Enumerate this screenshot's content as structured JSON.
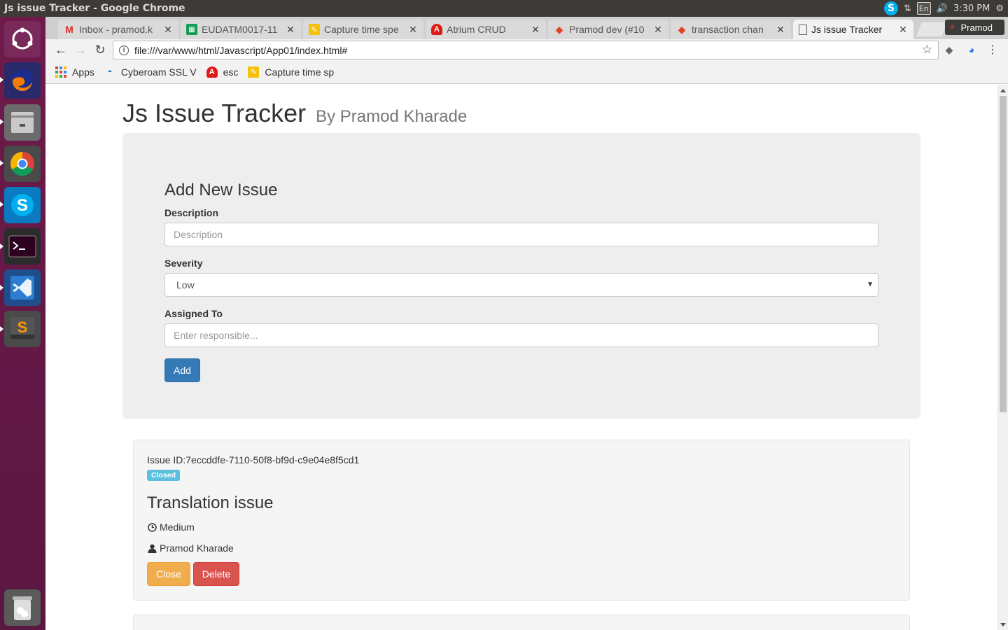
{
  "window": {
    "title": "Js issue Tracker - Google Chrome"
  },
  "system_tray": {
    "language": "En",
    "clock": "3:30 PM"
  },
  "tabs": [
    {
      "label": "Inbox - pramod.k",
      "icon": "gmail-icon"
    },
    {
      "label": "EUDATM0017-11",
      "icon": "sheets-icon"
    },
    {
      "label": "Capture time spe",
      "icon": "capture-icon"
    },
    {
      "label": "Atrium CRUD",
      "icon": "angular-icon"
    },
    {
      "label": "Pramod dev (#10",
      "icon": "gitlab-icon"
    },
    {
      "label": "transaction chan",
      "icon": "gitlab-icon"
    },
    {
      "label": "Js issue Tracker",
      "icon": "page-icon"
    }
  ],
  "profile": {
    "name": "Pramod"
  },
  "address_bar": {
    "url": "file:///var/www/html/Javascript/App01/index.html#"
  },
  "bookmarks": [
    {
      "label": "Apps",
      "icon": "apps-grid-icon"
    },
    {
      "label": "Cyberoam SSL V",
      "icon": "cyberoam-icon"
    },
    {
      "label": "esc",
      "icon": "angular-icon"
    },
    {
      "label": "Capture time sp",
      "icon": "capture-icon"
    }
  ],
  "page": {
    "title": "Js Issue Tracker",
    "subtitle": "By Pramod Kharade",
    "form": {
      "heading": "Add New Issue",
      "description_label": "Description",
      "description_placeholder": "Description",
      "severity_label": "Severity",
      "severity_value": "Low",
      "assigned_label": "Assigned To",
      "assigned_placeholder": "Enter responsible...",
      "add_button": "Add"
    },
    "issues": [
      {
        "id_text": "Issue ID:7eccddfe-7110-50f8-bf9d-c9e04e8f5cd1",
        "status": "Closed",
        "description": "Translation issue",
        "severity": "Medium",
        "assigned_to": "Pramod Kharade",
        "close_button": "Close",
        "delete_button": "Delete"
      }
    ]
  },
  "colors": {
    "primary": "#337ab7",
    "warning": "#f0ad4e",
    "danger": "#d9534f",
    "info": "#5bc0de",
    "launcher": "#6e1a4b"
  }
}
